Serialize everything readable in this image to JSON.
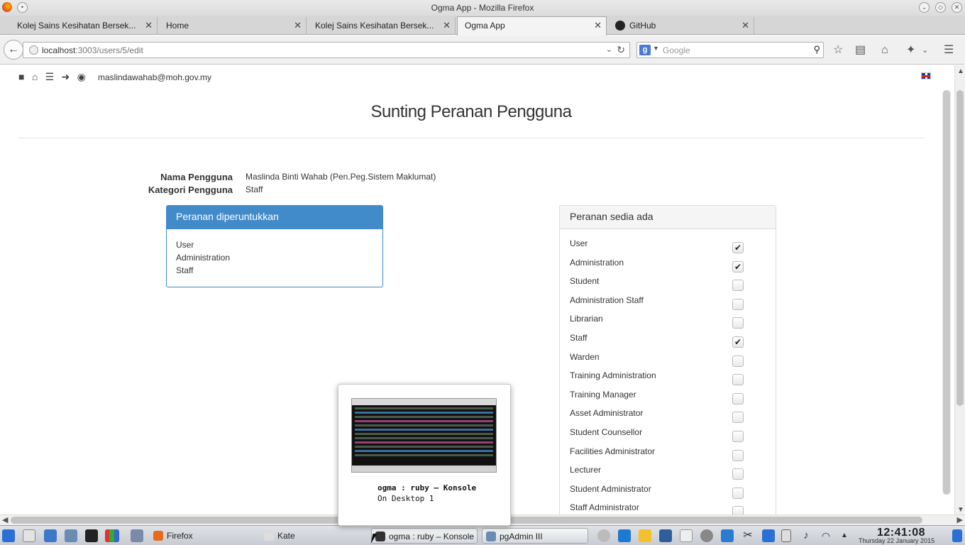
{
  "window": {
    "title": "Ogma App - Mozilla Firefox"
  },
  "tabs": [
    {
      "label": "Kolej Sains Kesihatan Bersek...",
      "active": false
    },
    {
      "label": "Home",
      "active": false
    },
    {
      "label": "Kolej Sains Kesihatan Bersek...",
      "active": false
    },
    {
      "label": "Ogma App",
      "active": true
    },
    {
      "label": "GitHub",
      "active": false
    }
  ],
  "nav": {
    "url_host": "localhost",
    "url_path": ":3003/users/5/edit",
    "search_placeholder": "Google"
  },
  "page": {
    "user_email": "maslindawahab@moh.gov.my",
    "title": "Sunting Peranan Pengguna",
    "fields": {
      "name_label": "Nama Pengguna",
      "name_value": "Maslinda Binti Wahab (Pen.Peg.Sistem Maklumat)",
      "category_label": "Kategori Pengguna",
      "category_value": "Staff"
    },
    "assigned": {
      "heading": "Peranan diperuntukkan",
      "roles": [
        "User",
        "Administration",
        "Staff"
      ]
    },
    "available": {
      "heading": "Peranan sedia ada",
      "roles": [
        {
          "label": "User",
          "checked": true
        },
        {
          "label": "Administration",
          "checked": true
        },
        {
          "label": "Student",
          "checked": false
        },
        {
          "label": "Administration Staff",
          "checked": false
        },
        {
          "label": "Librarian",
          "checked": false
        },
        {
          "label": "Staff",
          "checked": true
        },
        {
          "label": "Warden",
          "checked": false
        },
        {
          "label": "Training Administration",
          "checked": false
        },
        {
          "label": "Training Manager",
          "checked": false
        },
        {
          "label": "Asset Administrator",
          "checked": false
        },
        {
          "label": "Student Counsellor",
          "checked": false
        },
        {
          "label": "Facilities Administrator",
          "checked": false
        },
        {
          "label": "Lecturer",
          "checked": false
        },
        {
          "label": "Student Administrator",
          "checked": false
        },
        {
          "label": "Staff Administrator",
          "checked": false
        }
      ]
    }
  },
  "taskbar": {
    "tasks": [
      {
        "label": "Firefox",
        "active": false
      },
      {
        "label": "Kate",
        "active": false
      },
      {
        "label": "ogma : ruby – Konsole",
        "active": true
      },
      {
        "label": "pgAdmin III",
        "active": true
      }
    ],
    "clock": "12:41:08",
    "date": "Thursday 22 January 2015"
  },
  "tooltip": {
    "title": "ogma : ruby – Konsole",
    "subtitle": "On Desktop 1"
  },
  "icons": {
    "back": "back-arrow-icon",
    "reload": "reload-icon",
    "bookmark": "star-icon",
    "home": "home-icon",
    "menu": "hamburger-icon"
  },
  "colors": {
    "primary": "#428bca",
    "panel_border": "#dddddd"
  }
}
